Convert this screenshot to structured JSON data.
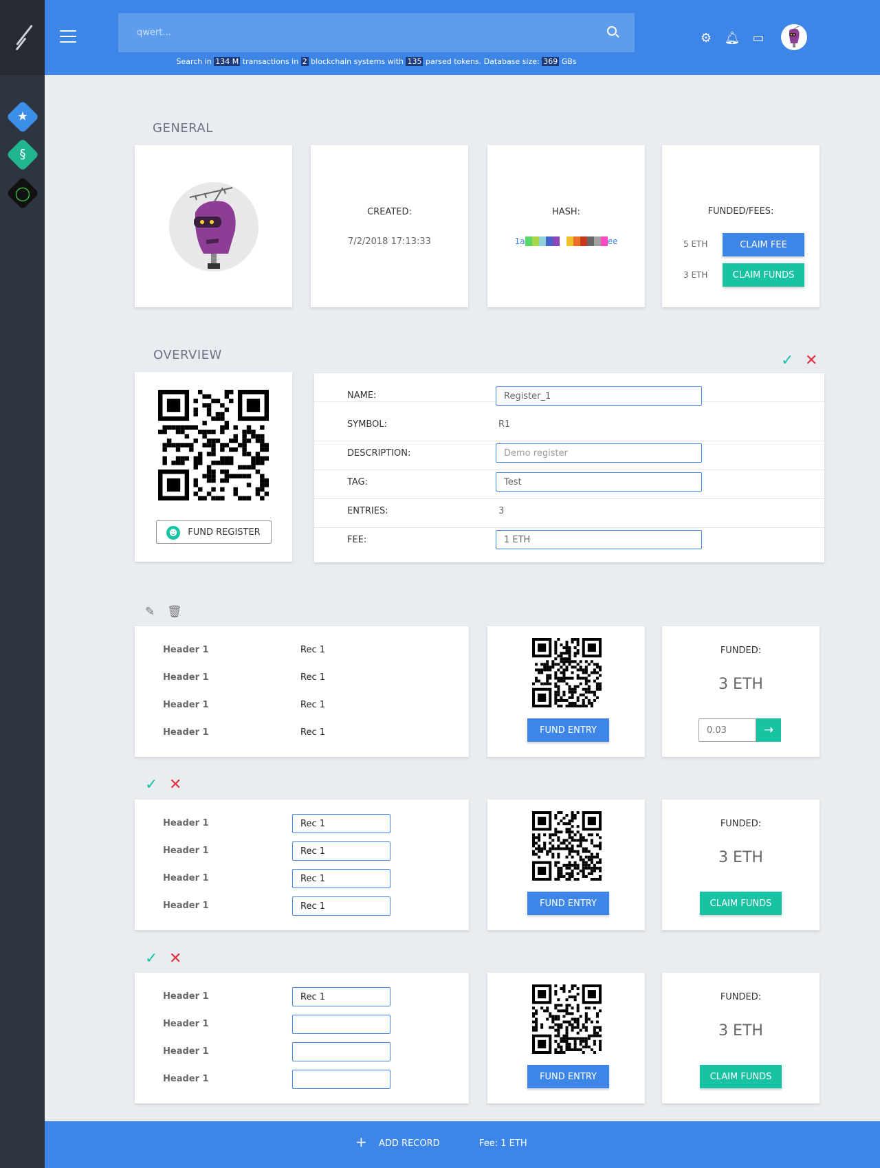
{
  "search": {
    "placeholder": "qwert..."
  },
  "stats": {
    "prefix": "Search in",
    "tx_count": "134 M",
    "mid1": "transactions in",
    "systems": "2",
    "mid2": "blockchain systems with",
    "tokens": "135",
    "mid3": "parsed tokens. Database size:",
    "db_size": "369",
    "suffix": "GBs"
  },
  "general": {
    "title": "GENERAL",
    "created_label": "CREATED:",
    "created_value": "7/2/2018 17:13:33",
    "hash_label": "HASH:",
    "hash_start": "1a",
    "hash_end": "ee",
    "hash_colors": [
      "#5bd66a",
      "#a6d84a",
      "#8fd1d9",
      "#4762c9",
      "#8b46b7",
      "#ffffff",
      "#f0c02b",
      "#e9712a",
      "#c33a1f",
      "#686868",
      "#a1a1a1",
      "#ff4bc3"
    ],
    "funded_label": "FUNDED/FEES:",
    "fee_amount": "5 ETH",
    "claim_fee_label": "CLAIM FEE",
    "funds_amount": "3 ETH",
    "claim_funds_label": "CLAIM FUNDS"
  },
  "overview": {
    "title": "OVERVIEW",
    "fund_register_label": "FUND REGISTER",
    "fields": {
      "name_label": "NAME:",
      "name_value": "Register_1",
      "symbol_label": "SYMBOL:",
      "symbol_value": "R1",
      "description_label": "DESCRIPTION:",
      "description_placeholder": "Demo register",
      "tag_label": "TAG:",
      "tag_value": "Test",
      "entries_label": "ENTRIES:",
      "entries_value": "3",
      "fee_label": "FEE:",
      "fee_value": "1 ETH"
    }
  },
  "records": [
    {
      "header": "Header 1",
      "values": [
        "Rec 1",
        "Rec 1",
        "Rec 1",
        "Rec 1"
      ],
      "fund_entry_label": "FUND ENTRY",
      "funded_label": "FUNDED:",
      "funded_value": "3 ETH",
      "amount_input": "0.03"
    },
    {
      "header": "Header 1",
      "values": [
        "Rec 1",
        "Rec 1",
        "Rec 1",
        "Rec 1"
      ],
      "fund_entry_label": "FUND ENTRY",
      "funded_label": "FUNDED:",
      "funded_value": "3 ETH",
      "claim_label": "CLAIM FUNDS"
    },
    {
      "header": "Header 1",
      "values": [
        "Rec 1",
        "",
        "",
        ""
      ],
      "fund_entry_label": "FUND ENTRY",
      "funded_label": "FUNDED:",
      "funded_value": "3 ETH",
      "claim_label": "CLAIM FUNDS"
    }
  ],
  "footer": {
    "add_record_label": "ADD RECORD",
    "fee_text": "Fee: 1 ETH"
  },
  "colors": {
    "primary": "#3d86e8",
    "accent": "#17c3a2",
    "danger": "#e0303b",
    "sidebar": "#2e3440"
  },
  "icons": [
    "menu-icon",
    "search-icon",
    "gear-icon",
    "bell-icon",
    "wallet-icon",
    "user-avatar",
    "star-coin-icon",
    "stumble-coin-icon",
    "ring-coin-icon",
    "check-icon",
    "close-icon",
    "pencil-icon",
    "trash-icon",
    "arrow-right-icon",
    "plus-icon",
    "qr-code"
  ]
}
